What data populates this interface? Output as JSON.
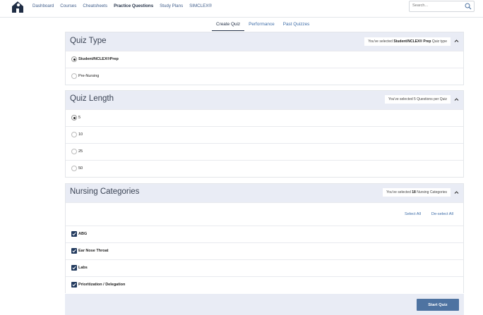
{
  "nav": {
    "links": [
      "Dashboard",
      "Courses",
      "Cheatsheets",
      "Practice Questions",
      "Study Plans",
      "SIMCLEX®"
    ],
    "active_index": 3,
    "search_placeholder": "Search..."
  },
  "tabs": [
    "Create Quiz",
    "Performance",
    "Past Quizzes"
  ],
  "quiz_type": {
    "title": "Quiz Type",
    "status_prefix": "You've selected ",
    "status_value": "Student/NCLEX® Prep",
    "status_suffix": " Quiz type",
    "options": [
      {
        "label": "Student/NCLEX®Prep",
        "checked": true
      },
      {
        "label": "Pre-Nursing",
        "checked": false
      }
    ]
  },
  "quiz_length": {
    "title": "Quiz Length",
    "status": "You've selected 5 Questions per Quiz",
    "options": [
      {
        "label": "5",
        "checked": true
      },
      {
        "label": "10",
        "checked": false
      },
      {
        "label": "25",
        "checked": false
      },
      {
        "label": "50",
        "checked": false
      }
    ]
  },
  "categories": {
    "title": "Nursing Categories",
    "status_prefix": "You've selected ",
    "status_value": "18",
    "status_suffix": " Nursing Categories",
    "select_all": "Select All",
    "deselect_all": "De-select All",
    "items": [
      {
        "label": "ABG",
        "checked": true
      },
      {
        "label": "Ear Nose Throat",
        "checked": true
      },
      {
        "label": "Labs",
        "checked": true
      },
      {
        "label": "Prioritization / Delegation",
        "checked": true
      }
    ]
  },
  "footer": {
    "start_label": "Start Quiz"
  },
  "colors": {
    "accent": "#4e73a1",
    "header_bg": "#e9ecf5",
    "checkbox": "#223a5e"
  }
}
